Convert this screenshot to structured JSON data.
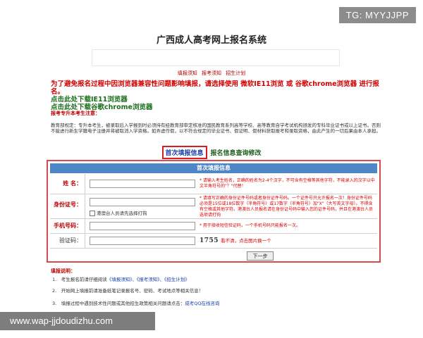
{
  "watermark_top": "TG: MYYJJPP",
  "watermark_bottom": "www.wap-jjdoudizhu.com",
  "header": {
    "title": "广西成人高考网上报名系统"
  },
  "topnav": [
    "填报须知",
    "报考须知",
    "招生计划"
  ],
  "notice": {
    "red": "为了避免报名过程中因浏览器兼容性问题影响填报，请选择使用 微软IE11浏览 或 谷歌chrome浏览器 进行报名。",
    "link_ie": "点击此处下载IE11浏览器",
    "link_chrome": "点击此处下载谷歌chrome浏览器"
  },
  "rules": {
    "title": "报考专升本考生注意：",
    "body": "教育部规定：专升本考生，被录取后入学报到时必须持有经教育部审定核准的国民教育系列高等学校、高等教育自学考试机构颁发的专科毕业证书或以上证书。否则不能进行新生学籍电子注册并将被取消入学资格。如弄虚作假，以不符合规定的毕业证书、假证明、假材料获取报考和录取资格，由此产生的一切后果由本人承担。"
  },
  "tabs": {
    "first": "首次填报信息",
    "query": "报名信息查询修改"
  },
  "form": {
    "header": "首次填报信息",
    "name_label": "姓 名：",
    "name_hint": "* 请输入考生姓名，正确的姓名为2-4个汉字，不可含有空格等其他字符，不能录入的汉字以中文半角符号的\"？\"代替！",
    "id_label": "身份证号：",
    "id_hint": "* 请填写正确的身份证件号码或者身份证件号码。一个证件号只允许报名一次！身份证件号码必须是15位或18位数字（半角符号）或17数字（半角符号）加\"X\"（大写英文字母）。不得含有空格或其他字符。港澳台人员报名请在身份证号码中输入您的证件号码，并且在港澳台人员选项请打钩",
    "hk_checkbox": "港澳台人员请先选择打钩",
    "phone_label": "手机号码：",
    "phone_hint": "* 用于接收短信验证码，一个手机号码只能报名一次。",
    "captcha_label": "验证码：",
    "captcha_value": "1755",
    "captcha_hint": "看不清，点击图片换一个",
    "next_button": "下一步"
  },
  "help": {
    "title": "填报说明：",
    "item1_prefix": "1.　考生报名前请仔细阅读",
    "item1_links": "《填报须知》、《报考须知》、《招生计划》",
    "item2": "2.　开始网上填报前请准备纸笔记录报名号、密码、考试地点等相关信息！",
    "item3_prefix": "3.　填报过程中遇到技术性问题或其他招生政策相关问题请点击：",
    "item3_link": "成考QQ在线咨询"
  }
}
